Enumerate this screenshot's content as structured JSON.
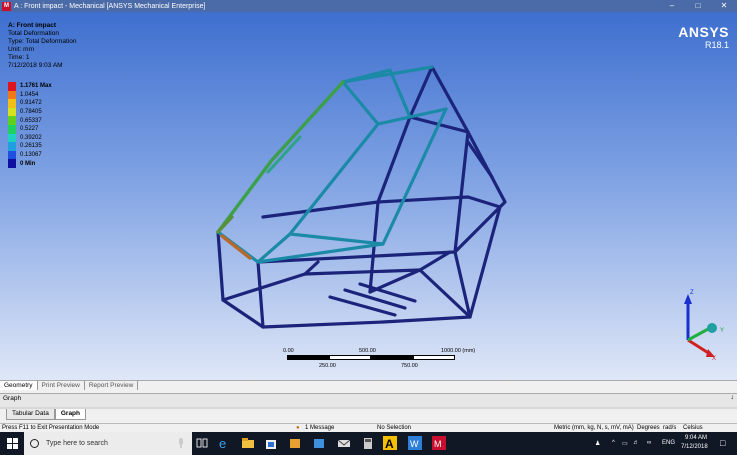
{
  "window": {
    "title": "A : Front impact - Mechanical [ANSYS Mechanical Enterprise]",
    "minimize_glyph": "–",
    "maximize_glyph": "□",
    "close_glyph": "✕"
  },
  "info": {
    "heading": "A: Front impact",
    "line1": "Total Deformation",
    "line2": "Type: Total Deformation",
    "line3": "Unit: mm",
    "line4": "Time: 1",
    "line5": "7/12/2018 9:03 AM"
  },
  "legend": [
    {
      "label": "1.1761 Max",
      "color": "#e0141e",
      "bold": true
    },
    {
      "label": "1.0454",
      "color": "#f07818"
    },
    {
      "label": "0.91472",
      "color": "#f0c018"
    },
    {
      "label": "0.78405",
      "color": "#d4e020"
    },
    {
      "label": "0.65337",
      "color": "#60d020"
    },
    {
      "label": "0.5227",
      "color": "#20d060"
    },
    {
      "label": "0.39202",
      "color": "#20d0c0"
    },
    {
      "label": "0.26135",
      "color": "#20a0e0"
    },
    {
      "label": "0.13067",
      "color": "#2050e0"
    },
    {
      "label": "0 Min",
      "color": "#1010a0",
      "bold": true
    }
  ],
  "brand": {
    "name": "ANSYS",
    "version": "R18.1"
  },
  "scale": {
    "top_left": "0.00",
    "top_mid": "500.00",
    "top_right": "1000.00 (mm)",
    "bottom_left": "250.00",
    "bottom_right": "750.00"
  },
  "triad": {
    "x": "X",
    "y": "Y",
    "z": "Z"
  },
  "view_tabs": [
    "Geometry",
    "Print Preview",
    "Report Preview"
  ],
  "graph_panel": {
    "title": "Graph",
    "pin_glyph": "↓"
  },
  "bottom_tabs": [
    "Tabular Data",
    "Graph"
  ],
  "status": {
    "left": "Press F11 to Exit Presentation Mode",
    "messages": "1 Message",
    "selection": "No Selection",
    "units": "Metric (mm, kg, N, s, mV, mA)",
    "angle": "Degrees",
    "rate": "rad/s",
    "temp": "Celsius"
  },
  "taskbar": {
    "search_placeholder": "Type here to search",
    "lang": "ENG",
    "time": "9:04 AM",
    "date": "7/12/2018"
  },
  "colors": {
    "frame_base": "#1a237e",
    "frame_mid": "#1a8aa6",
    "frame_high": "#3aa04c"
  }
}
